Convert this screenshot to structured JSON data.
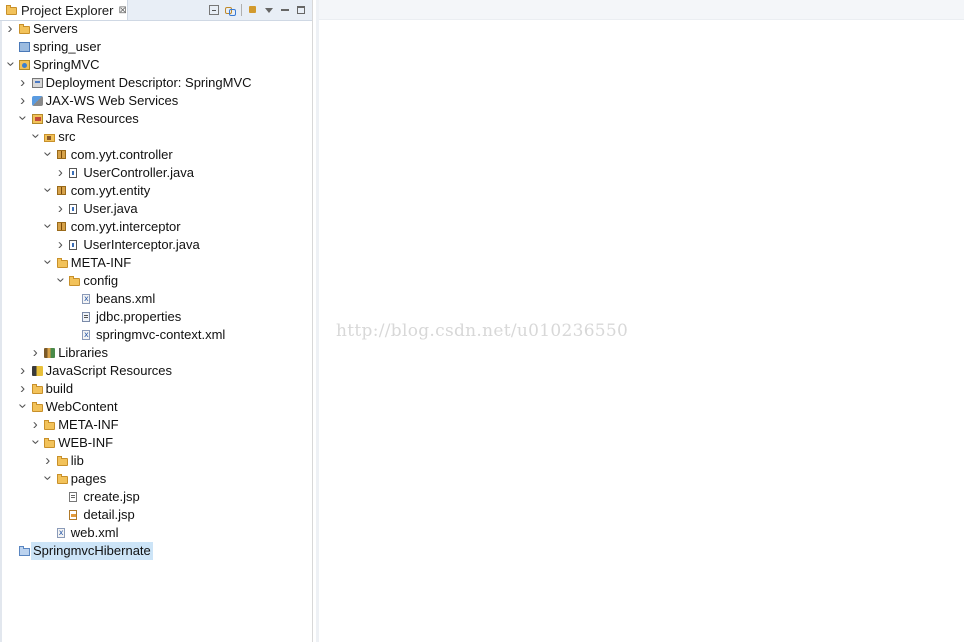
{
  "panel": {
    "title": "Project Explorer",
    "close_glyph": "⊠"
  },
  "toolbar": {
    "buttons": [
      {
        "name": "collapse-all-icon"
      },
      {
        "name": "link-with-editor-icon"
      },
      {
        "name": "focus-icon"
      },
      {
        "name": "view-menu-icon"
      },
      {
        "name": "minimize-icon"
      },
      {
        "name": "maximize-icon"
      }
    ]
  },
  "tree": [
    {
      "label": "Servers",
      "level": 0,
      "expand": "closed",
      "icon": "folder"
    },
    {
      "label": "spring_user",
      "level": 0,
      "expand": "none",
      "icon": "server"
    },
    {
      "label": "SpringMVC",
      "level": 0,
      "expand": "open",
      "icon": "webproj"
    },
    {
      "label": "Deployment Descriptor: SpringMVC",
      "level": 1,
      "expand": "closed",
      "icon": "descriptor"
    },
    {
      "label": "JAX-WS Web Services",
      "level": 1,
      "expand": "closed",
      "icon": "webservice"
    },
    {
      "label": "Java Resources",
      "level": 1,
      "expand": "open",
      "icon": "javares"
    },
    {
      "label": "src",
      "level": 2,
      "expand": "open",
      "icon": "srcfolder"
    },
    {
      "label": "com.yyt.controller",
      "level": 3,
      "expand": "open",
      "icon": "package"
    },
    {
      "label": "UserController.java",
      "level": 4,
      "expand": "closed",
      "icon": "java"
    },
    {
      "label": "com.yyt.entity",
      "level": 3,
      "expand": "open",
      "icon": "package"
    },
    {
      "label": "User.java",
      "level": 4,
      "expand": "closed",
      "icon": "java"
    },
    {
      "label": "com.yyt.interceptor",
      "level": 3,
      "expand": "open",
      "icon": "package"
    },
    {
      "label": "UserInterceptor.java",
      "level": 4,
      "expand": "closed",
      "icon": "java"
    },
    {
      "label": "META-INF",
      "level": 3,
      "expand": "open",
      "icon": "folder"
    },
    {
      "label": "config",
      "level": 4,
      "expand": "open",
      "icon": "folder"
    },
    {
      "label": "beans.xml",
      "level": 5,
      "expand": "none",
      "icon": "xml"
    },
    {
      "label": "jdbc.properties",
      "level": 5,
      "expand": "none",
      "icon": "props"
    },
    {
      "label": "springmvc-context.xml",
      "level": 5,
      "expand": "none",
      "icon": "xml"
    },
    {
      "label": "Libraries",
      "level": 2,
      "expand": "closed",
      "icon": "library"
    },
    {
      "label": "JavaScript Resources",
      "level": 1,
      "expand": "closed",
      "icon": "jsres"
    },
    {
      "label": "build",
      "level": 1,
      "expand": "closed",
      "icon": "folder"
    },
    {
      "label": "WebContent",
      "level": 1,
      "expand": "open",
      "icon": "folder"
    },
    {
      "label": "META-INF",
      "level": 2,
      "expand": "closed",
      "icon": "folder"
    },
    {
      "label": "WEB-INF",
      "level": 2,
      "expand": "open",
      "icon": "folder"
    },
    {
      "label": "lib",
      "level": 3,
      "expand": "closed",
      "icon": "folder"
    },
    {
      "label": "pages",
      "level": 3,
      "expand": "open",
      "icon": "folder"
    },
    {
      "label": "create.jsp",
      "level": 4,
      "expand": "none",
      "icon": "jsp"
    },
    {
      "label": "detail.jsp",
      "level": 4,
      "expand": "none",
      "icon": "jsp-edit"
    },
    {
      "label": "web.xml",
      "level": 3,
      "expand": "none",
      "icon": "xml"
    },
    {
      "label": "SpringmvcHibernate",
      "level": 0,
      "expand": "none",
      "icon": "project",
      "selected": true
    }
  ],
  "editor": {
    "watermark": "http://blog.csdn.net/u010236550"
  },
  "colors": {
    "selection": "#cce4f7",
    "header_bg": "#e8eef6"
  }
}
